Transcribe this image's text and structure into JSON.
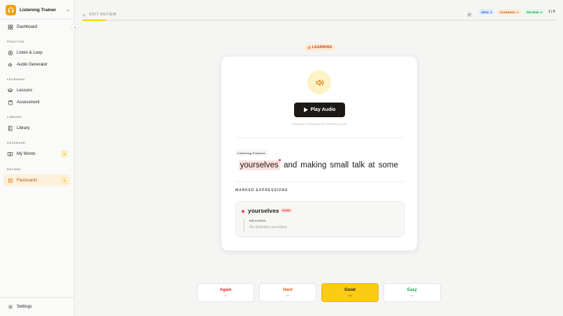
{
  "app": {
    "title": "Listening Trainer",
    "accent_color": "#f59e0b"
  },
  "sidebar": {
    "dashboard": {
      "label": "Dashboard",
      "icon": "dashboard-icon"
    },
    "sections": {
      "practice": "PRACTICE",
      "learning": "LEARNING",
      "library": "LIBRARY",
      "database": "DATABASE",
      "review": "REVIEW"
    },
    "items": [
      {
        "label": "Listen & Loop",
        "icon": "loop-icon"
      },
      {
        "label": "Audio Generator",
        "icon": "speaker-icon"
      },
      {
        "label": "Lessons",
        "icon": "graduation-cap-icon"
      },
      {
        "label": "Assessment",
        "icon": "clipboard-icon"
      },
      {
        "label": "Library",
        "icon": "book-icon"
      },
      {
        "label": "My Words",
        "icon": "open-book-icon",
        "badge": "1"
      },
      {
        "label": "Flashcards",
        "icon": "cards-icon",
        "badge": "1",
        "active": true
      }
    ],
    "settings": {
      "label": "Settings",
      "icon": "gear-icon"
    }
  },
  "topbar": {
    "exit_label": "EXIT REVIEW",
    "counts": {
      "new": "NEW: 4",
      "learning": "LEARNING: 2",
      "review": "REVIEW: 0"
    },
    "progress_text": "1 / 6",
    "progress_fraction": 0.05
  },
  "card": {
    "status": "LEARNING",
    "play_label": "Play Audio",
    "hint": "Audio plays in background with the sentence audio",
    "practice_tag": "Listening Practice",
    "sentence": {
      "marked": "yourselves",
      "rest": [
        "and",
        "making",
        "small",
        "talk",
        "at",
        "some"
      ]
    },
    "marked_title": "MARKED EXPRESSIONS",
    "expression": {
      "word": "yourselves",
      "type": "WORD",
      "meaning_label": "MEANING",
      "meaning_text": "No definition provided."
    }
  },
  "ratings": [
    {
      "label": "Again",
      "sub": "1m"
    },
    {
      "label": "Hard",
      "sub": "5m"
    },
    {
      "label": "Good",
      "sub": "10m"
    },
    {
      "label": "Easy",
      "sub": "4d"
    }
  ]
}
